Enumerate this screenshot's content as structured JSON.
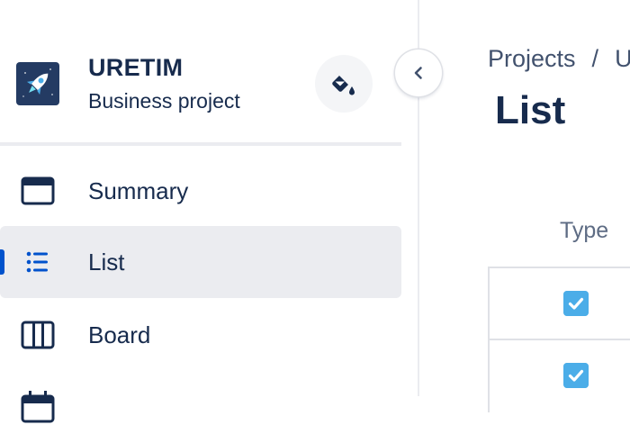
{
  "sidebar": {
    "project": {
      "name": "URETIM",
      "type": "Business project",
      "avatar_icon": "rocket-icon"
    },
    "nav_items": [
      {
        "label": "Summary",
        "icon": "summary-icon",
        "active": false
      },
      {
        "label": "List",
        "icon": "list-icon",
        "active": true
      },
      {
        "label": "Board",
        "icon": "board-icon",
        "active": false
      }
    ]
  },
  "main": {
    "breadcrumb": [
      "Projects",
      "/",
      "U"
    ],
    "title": "List",
    "table": {
      "columns": [
        "Type"
      ],
      "rows": [
        {
          "type": "task"
        },
        {
          "type": "task"
        }
      ]
    }
  },
  "colors": {
    "accent": "#0052cc",
    "active_bg": "#ebecf0",
    "text": "#172b4d",
    "task_icon": "#4bade8",
    "avatar_bg": "#243b63"
  }
}
